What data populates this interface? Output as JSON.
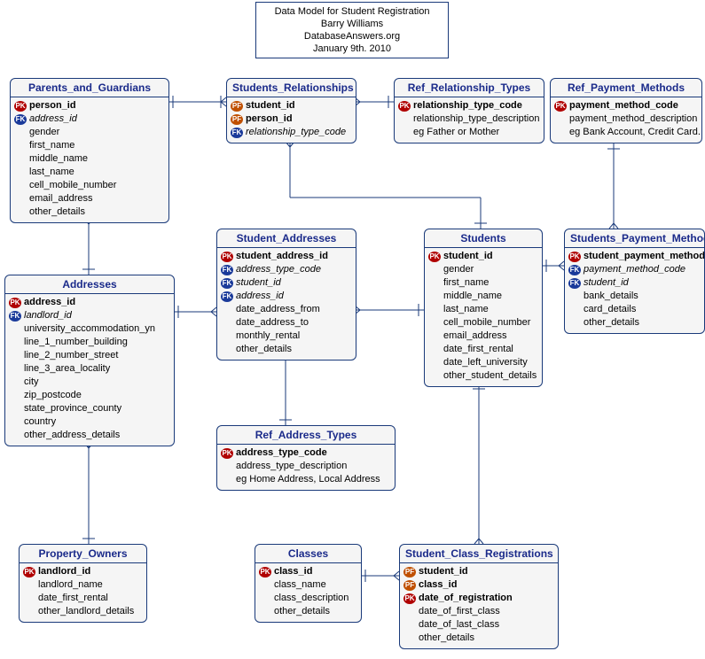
{
  "title": {
    "line1": "Data Model for Student Registration",
    "line2": "Barry Williams",
    "line3": "DatabaseAnswers.org",
    "line4": "January 9th. 2010"
  },
  "entities": {
    "parents_and_guardians": {
      "name": "Parents_and_Guardians",
      "cols": [
        {
          "k": "pk",
          "t": "person_id",
          "b": true
        },
        {
          "k": "fk",
          "t": "address_id",
          "i": true
        },
        {
          "k": "",
          "t": "gender"
        },
        {
          "k": "",
          "t": "first_name"
        },
        {
          "k": "",
          "t": "middle_name"
        },
        {
          "k": "",
          "t": "last_name"
        },
        {
          "k": "",
          "t": "cell_mobile_number"
        },
        {
          "k": "",
          "t": "email_address"
        },
        {
          "k": "",
          "t": "other_details"
        }
      ]
    },
    "students_relationships": {
      "name": "Students_Relationships",
      "cols": [
        {
          "k": "pf",
          "t": "student_id",
          "b": true
        },
        {
          "k": "pf",
          "t": "person_id",
          "b": true
        },
        {
          "k": "fk",
          "t": "relationship_type_code",
          "i": true
        }
      ]
    },
    "ref_relationship_types": {
      "name": "Ref_Relationship_Types",
      "cols": [
        {
          "k": "pk",
          "t": "relationship_type_code",
          "b": true
        },
        {
          "k": "",
          "t": "relationship_type_description"
        },
        {
          "k": "",
          "t": "eg Father or Mother"
        }
      ]
    },
    "ref_payment_methods": {
      "name": "Ref_Payment_Methods",
      "cols": [
        {
          "k": "pk",
          "t": "payment_method_code",
          "b": true
        },
        {
          "k": "",
          "t": "payment_method_description"
        },
        {
          "k": "",
          "t": "eg Bank Account, Credit Card."
        }
      ]
    },
    "addresses": {
      "name": "Addresses",
      "cols": [
        {
          "k": "pk",
          "t": "address_id",
          "b": true
        },
        {
          "k": "fk",
          "t": "landlord_id",
          "i": true
        },
        {
          "k": "",
          "t": "university_accommodation_yn"
        },
        {
          "k": "",
          "t": "line_1_number_building"
        },
        {
          "k": "",
          "t": "line_2_number_street"
        },
        {
          "k": "",
          "t": "line_3_area_locality"
        },
        {
          "k": "",
          "t": "city"
        },
        {
          "k": "",
          "t": "zip_postcode"
        },
        {
          "k": "",
          "t": "state_province_county"
        },
        {
          "k": "",
          "t": "country"
        },
        {
          "k": "",
          "t": "other_address_details"
        }
      ]
    },
    "student_addresses": {
      "name": "Student_Addresses",
      "cols": [
        {
          "k": "pk",
          "t": "student_address_id",
          "b": true
        },
        {
          "k": "fk",
          "t": "address_type_code",
          "i": true
        },
        {
          "k": "fk",
          "t": "student_id",
          "i": true
        },
        {
          "k": "fk",
          "t": "address_id",
          "i": true
        },
        {
          "k": "",
          "t": "date_address_from"
        },
        {
          "k": "",
          "t": "date_address_to"
        },
        {
          "k": "",
          "t": "monthly_rental"
        },
        {
          "k": "",
          "t": "other_details"
        }
      ]
    },
    "students": {
      "name": "Students",
      "cols": [
        {
          "k": "pk",
          "t": "student_id",
          "b": true
        },
        {
          "k": "",
          "t": "gender"
        },
        {
          "k": "",
          "t": "first_name"
        },
        {
          "k": "",
          "t": "middle_name"
        },
        {
          "k": "",
          "t": "last_name"
        },
        {
          "k": "",
          "t": "cell_mobile_number"
        },
        {
          "k": "",
          "t": "email_address"
        },
        {
          "k": "",
          "t": "date_first_rental"
        },
        {
          "k": "",
          "t": "date_left_university"
        },
        {
          "k": "",
          "t": "other_student_details"
        }
      ]
    },
    "students_payment_methods": {
      "name": "Students_Payment_Methods",
      "cols": [
        {
          "k": "pk",
          "t": "student_payment_method_id",
          "b": true
        },
        {
          "k": "fk",
          "t": "payment_method_code",
          "i": true
        },
        {
          "k": "fk",
          "t": "student_id",
          "i": true
        },
        {
          "k": "",
          "t": "bank_details"
        },
        {
          "k": "",
          "t": "card_details"
        },
        {
          "k": "",
          "t": "other_details"
        }
      ]
    },
    "ref_address_types": {
      "name": "Ref_Address_Types",
      "cols": [
        {
          "k": "pk",
          "t": "address_type_code",
          "b": true
        },
        {
          "k": "",
          "t": "address_type_description"
        },
        {
          "k": "",
          "t": "eg Home Address, Local Address"
        }
      ]
    },
    "property_owners": {
      "name": "Property_Owners",
      "cols": [
        {
          "k": "pk",
          "t": "landlord_id",
          "b": true
        },
        {
          "k": "",
          "t": "landlord_name"
        },
        {
          "k": "",
          "t": "date_first_rental"
        },
        {
          "k": "",
          "t": "other_landlord_details"
        }
      ]
    },
    "classes": {
      "name": "Classes",
      "cols": [
        {
          "k": "pk",
          "t": "class_id",
          "b": true
        },
        {
          "k": "",
          "t": "class_name"
        },
        {
          "k": "",
          "t": "class_description"
        },
        {
          "k": "",
          "t": "other_details"
        }
      ]
    },
    "student_class_registrations": {
      "name": "Student_Class_Registrations",
      "cols": [
        {
          "k": "pf",
          "t": "student_id",
          "b": true
        },
        {
          "k": "pf",
          "t": "class_id",
          "b": true
        },
        {
          "k": "pk",
          "t": "date_of_registration",
          "b": true
        },
        {
          "k": "",
          "t": "date_of_first_class"
        },
        {
          "k": "",
          "t": "date_of_last_class"
        },
        {
          "k": "",
          "t": "other_details"
        }
      ]
    }
  }
}
